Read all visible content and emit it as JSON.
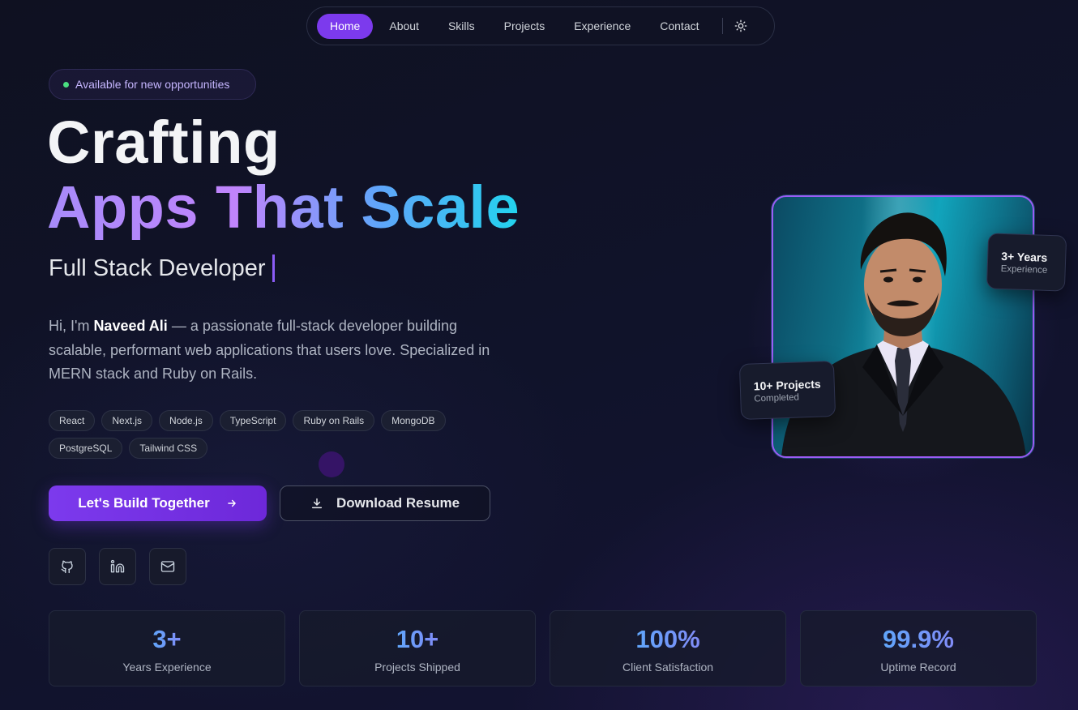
{
  "nav": {
    "items": [
      {
        "label": "Home",
        "active": true
      },
      {
        "label": "About"
      },
      {
        "label": "Skills"
      },
      {
        "label": "Projects"
      },
      {
        "label": "Experience"
      },
      {
        "label": "Contact"
      }
    ],
    "theme_icon": "sun-icon"
  },
  "hero": {
    "badge": "Available for new opportunities",
    "headline_line1": "Crafting",
    "headline_line2": "Apps That Scale",
    "role": "Full Stack Developer",
    "bio_prefix": "Hi, I'm ",
    "bio_name": "Naveed Ali",
    "bio_rest": " — a passionate full-stack developer building scalable, performant web applications that users love. Specialized in MERN stack and Ruby on Rails.",
    "tags": [
      "React",
      "Next.js",
      "Node.js",
      "TypeScript",
      "Ruby on Rails",
      "MongoDB",
      "PostgreSQL",
      "Tailwind CSS"
    ],
    "primary_cta": "Let's Build Together",
    "secondary_cta": "Download Resume",
    "socials": [
      "github-icon",
      "linkedin-icon",
      "mail-icon"
    ]
  },
  "portrait": {
    "card_experience_title": "3+ Years",
    "card_experience_sub": "Experience",
    "card_projects_title": "10+ Projects",
    "card_projects_sub": "Completed"
  },
  "stats": [
    {
      "value": "3+",
      "label": "Years Experience"
    },
    {
      "value": "10+",
      "label": "Projects Shipped"
    },
    {
      "value": "100%",
      "label": "Client Satisfaction"
    },
    {
      "value": "99.9%",
      "label": "Uptime Record"
    }
  ],
  "colors": {
    "accent": "#7c3aed",
    "background": "#10132a",
    "status_dot": "#4ade80"
  }
}
